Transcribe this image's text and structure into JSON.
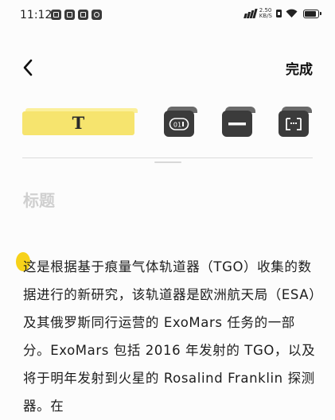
{
  "status_bar": {
    "time": "11:12",
    "net_speed_value": "2.50",
    "net_speed_unit": "KB/S",
    "signal_label": "4G",
    "battery_level_percent": 90,
    "app_icons": [
      "notification-app-icon",
      "gallery-app-icon",
      "message-app-icon",
      "video-app-icon"
    ]
  },
  "header": {
    "back_icon": "chevron-left-icon",
    "done_label": "完成"
  },
  "toolbar": {
    "text_tool_label": "T",
    "list_tool_label": "01",
    "tools": [
      "text-style-tool",
      "numbered-list-tool",
      "divider-tool",
      "quote-tool"
    ],
    "accent_color": "#f6e46e",
    "key_color": "#3b3b3b"
  },
  "editor": {
    "title_placeholder": "标题",
    "body_text": "这是根据基于痕量气体轨道器（TGO）收集的数据进行的新研究，该轨道器是欧洲航天局（ESA）及其俄罗斯同行运营的 ExoMars 任务的一部分。ExoMars 包括 2016 年发射的 TGO，以及将于明年发射到火星的 Rosalind Franklin 探测器。在",
    "cursor_handle_color": "#f7d21a"
  }
}
